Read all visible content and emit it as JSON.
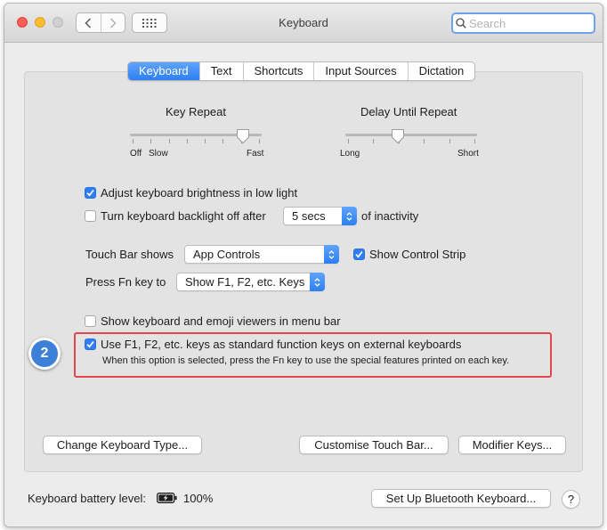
{
  "window": {
    "title": "Keyboard"
  },
  "search": {
    "placeholder": "Search",
    "value": ""
  },
  "tabs": [
    {
      "label": "Keyboard",
      "active": true
    },
    {
      "label": "Text",
      "active": false
    },
    {
      "label": "Shortcuts",
      "active": false
    },
    {
      "label": "Input Sources",
      "active": false
    },
    {
      "label": "Dictation",
      "active": false
    }
  ],
  "key_repeat": {
    "label": "Key Repeat",
    "min_label": "Off",
    "min2_label": "Slow",
    "max_label": "Fast",
    "level": 0.86
  },
  "delay_until_repeat": {
    "label": "Delay Until Repeat",
    "min_label": "Long",
    "max_label": "Short",
    "level": 0.4
  },
  "options": {
    "adjust_brightness": {
      "label": "Adjust keyboard brightness in low light",
      "checked": true
    },
    "backlight_off": {
      "label": "Turn keyboard backlight off after",
      "checked": false,
      "value": "5 secs",
      "suffix": "of inactivity"
    },
    "touch_bar": {
      "label": "Touch Bar shows",
      "value": "App Controls"
    },
    "control_strip": {
      "label": "Show Control Strip",
      "checked": true
    },
    "fn_key": {
      "label": "Press Fn key to",
      "value": "Show F1, F2, etc. Keys"
    },
    "emoji_viewers": {
      "label": "Show keyboard and emoji viewers in menu bar",
      "checked": false
    },
    "standard_fn": {
      "label": "Use F1, F2, etc. keys as standard function keys on external keyboards",
      "checked": true,
      "description": "When this option is selected, press the Fn key to use the special features printed on each key."
    }
  },
  "callout": {
    "number": "2"
  },
  "buttons": {
    "change_type": "Change Keyboard Type...",
    "customise_touch_bar": "Customise Touch Bar...",
    "modifier_keys": "Modifier Keys...",
    "bluetooth": "Set Up Bluetooth Keyboard...",
    "help": "?"
  },
  "battery": {
    "label": "Keyboard battery level:",
    "value": "100%"
  },
  "colors": {
    "accent": "#2f7ff2",
    "highlight": "#e0484e",
    "callout": "#3c80d8"
  }
}
